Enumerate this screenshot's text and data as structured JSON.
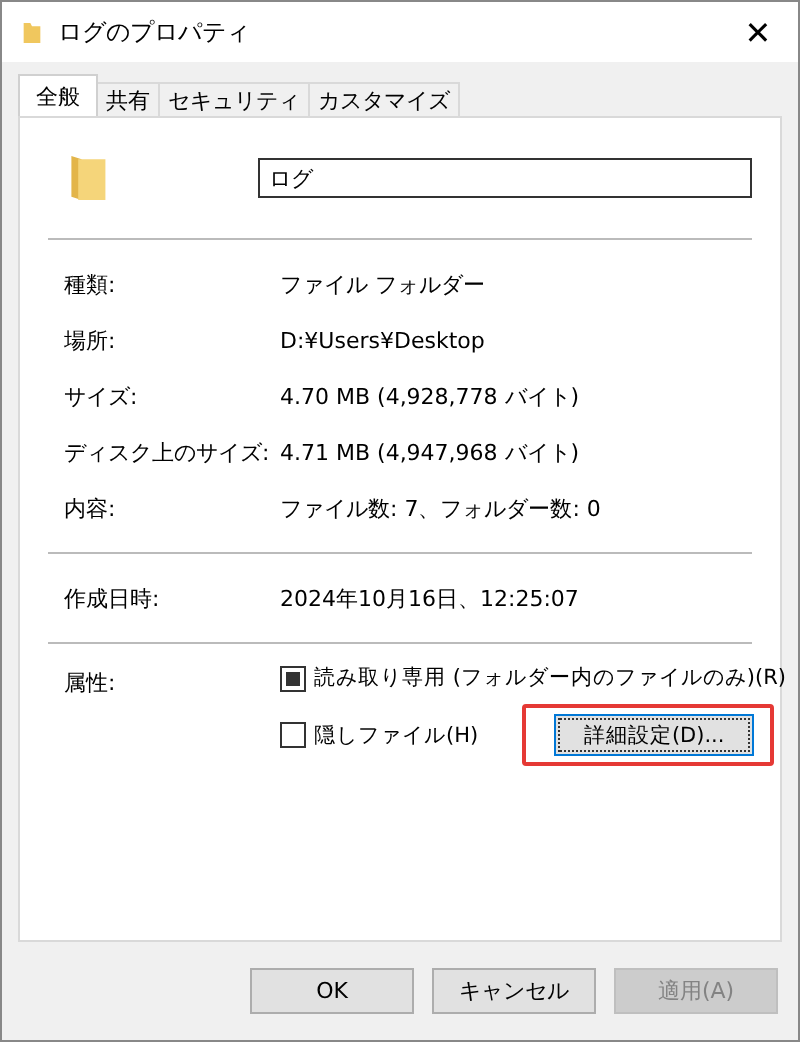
{
  "window": {
    "title": "ログのプロパティ",
    "close": "✕"
  },
  "tabs": [
    {
      "label": "全般",
      "selected": true
    },
    {
      "label": "共有",
      "selected": false
    },
    {
      "label": "セキュリティ",
      "selected": false
    },
    {
      "label": "カスタマイズ",
      "selected": false
    }
  ],
  "name_field": {
    "value": "ログ"
  },
  "groups": [
    [
      {
        "label": "種類:",
        "value": "ファイル フォルダー"
      },
      {
        "label": "場所:",
        "value": "D:¥Users¥Desktop"
      },
      {
        "label": "サイズ:",
        "value": "4.70 MB (4,928,778 バイト)"
      },
      {
        "label": "ディスク上のサイズ:",
        "value": "4.71 MB (4,947,968 バイト)"
      },
      {
        "label": "内容:",
        "value": "ファイル数: 7、フォルダー数: 0"
      }
    ],
    [
      {
        "label": "作成日時:",
        "value": "2024年10月16日、12:25:07"
      }
    ]
  ],
  "attributes": {
    "label": "属性:",
    "checkboxes": [
      {
        "label": "読み取り専用 (フォルダー内のファイルのみ)(R)",
        "checked": false,
        "indeterminate": true
      },
      {
        "label": "隠しファイル(H)",
        "checked": false,
        "indeterminate": false
      }
    ],
    "advanced_button": {
      "label": "詳細設定(D)...",
      "highlighted": true
    }
  },
  "buttons": [
    {
      "label": "OK",
      "disabled": false
    },
    {
      "label": "キャンセル",
      "disabled": false
    },
    {
      "label": "適用(A)",
      "disabled": true
    }
  ]
}
